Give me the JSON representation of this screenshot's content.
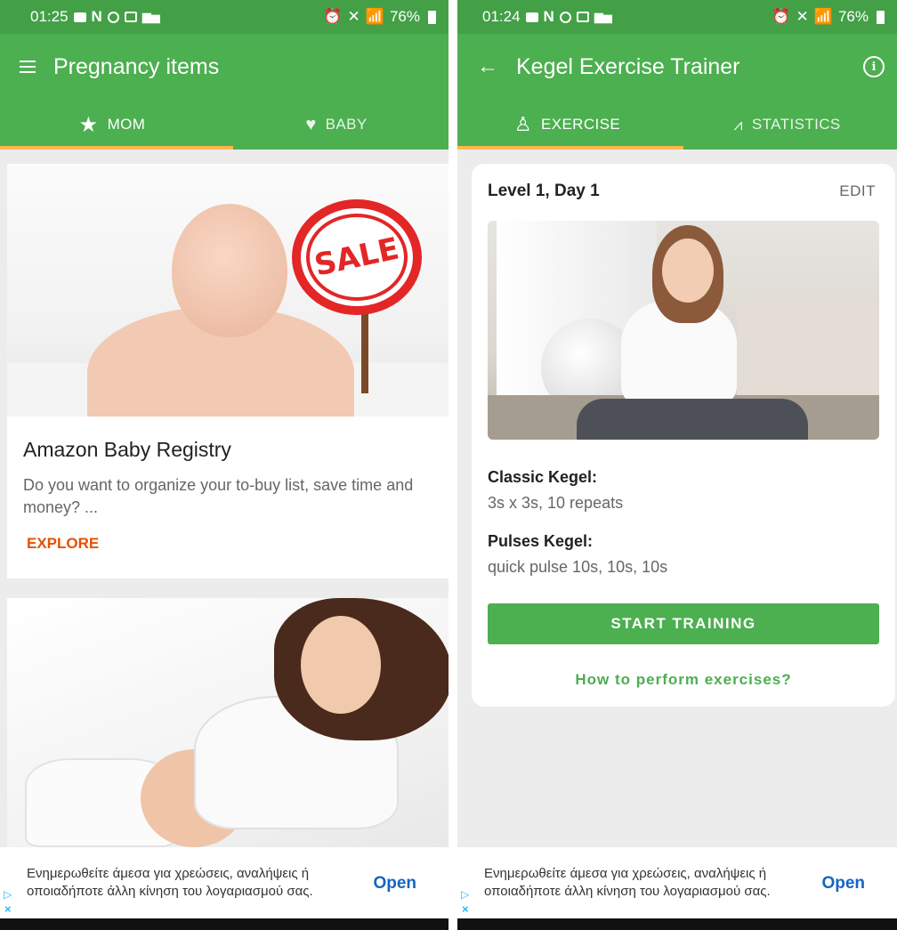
{
  "left": {
    "status": {
      "time": "01:25",
      "left_icons": [
        "message-icon",
        "n-icon",
        "instagram-icon",
        "gallery-icon",
        "bars-icon"
      ],
      "battery": "76%"
    },
    "appbar": {
      "title": "Pregnancy items"
    },
    "tabs": [
      {
        "label": "MOM",
        "icon": "star-icon"
      },
      {
        "label": "BABY",
        "icon": "heart-icon"
      }
    ],
    "card": {
      "image_text": "SALE",
      "title": "Amazon Baby Registry",
      "description": "Do you want to organize your to-buy list, save time and money? ...",
      "link": "EXPLORE"
    },
    "ad": {
      "text": "Ενημερωθείτε άμεσα για χρεώσεις, αναλήψεις ή οποιαδήποτε άλλη κίνηση του λογαριασμού σας.",
      "open": "Open",
      "close": "×"
    }
  },
  "right": {
    "status": {
      "time": "01:24",
      "left_icons": [
        "message-icon",
        "n-icon",
        "instagram-icon",
        "gallery-icon",
        "bars-icon"
      ],
      "battery": "76%"
    },
    "appbar": {
      "title": "Kegel Exercise Trainer",
      "info": "i"
    },
    "tabs": [
      {
        "label": "EXERCISE",
        "icon": "person-meditate-icon"
      },
      {
        "label": "STATISTICS",
        "icon": "chart-line-icon"
      }
    ],
    "card": {
      "level": "Level 1, Day 1",
      "edit": "EDIT",
      "exercises": [
        {
          "title": "Classic Kegel:",
          "desc": "3s x 3s, 10 repeats"
        },
        {
          "title": "Pulses Kegel:",
          "desc": "quick pulse 10s, 10s, 10s"
        }
      ],
      "start": "START TRAINING",
      "howto": "How to perform exercises?"
    },
    "ad": {
      "text": "Ενημερωθείτε άμεσα για χρεώσεις, αναλήψεις ή οποιαδήποτε άλλη κίνηση του λογαριασμού σας.",
      "open": "Open",
      "close": "×"
    }
  },
  "colors": {
    "primary": "#4caf50",
    "status_bar": "#43a047",
    "tab_indicator": "#ffb74d",
    "link": "#e65100",
    "ad_button": "#1565c0"
  }
}
